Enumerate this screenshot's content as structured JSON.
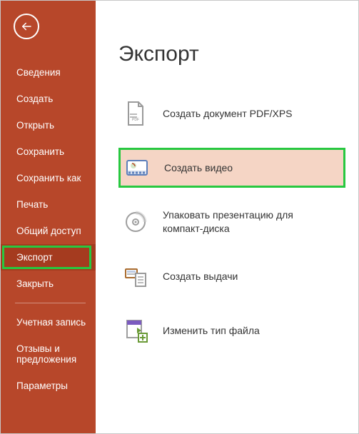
{
  "sidebar": {
    "items": [
      {
        "label": "Сведения"
      },
      {
        "label": "Создать"
      },
      {
        "label": "Открыть"
      },
      {
        "label": "Сохранить"
      },
      {
        "label": "Сохранить как"
      },
      {
        "label": "Печать"
      },
      {
        "label": "Общий доступ"
      },
      {
        "label": "Экспорт",
        "selected": true,
        "highlight": true
      },
      {
        "label": "Закрыть"
      }
    ],
    "footer": [
      {
        "label": "Учетная запись"
      },
      {
        "label": "Отзывы и предложения"
      },
      {
        "label": "Параметры"
      }
    ]
  },
  "content": {
    "title": "Экспорт",
    "options": [
      {
        "label": "Создать документ PDF/XPS"
      },
      {
        "label": "Создать видео",
        "selected": true
      },
      {
        "label": "Упаковать презентацию для компакт-диска"
      },
      {
        "label": "Создать выдачи"
      },
      {
        "label": "Изменить тип файла"
      }
    ]
  }
}
